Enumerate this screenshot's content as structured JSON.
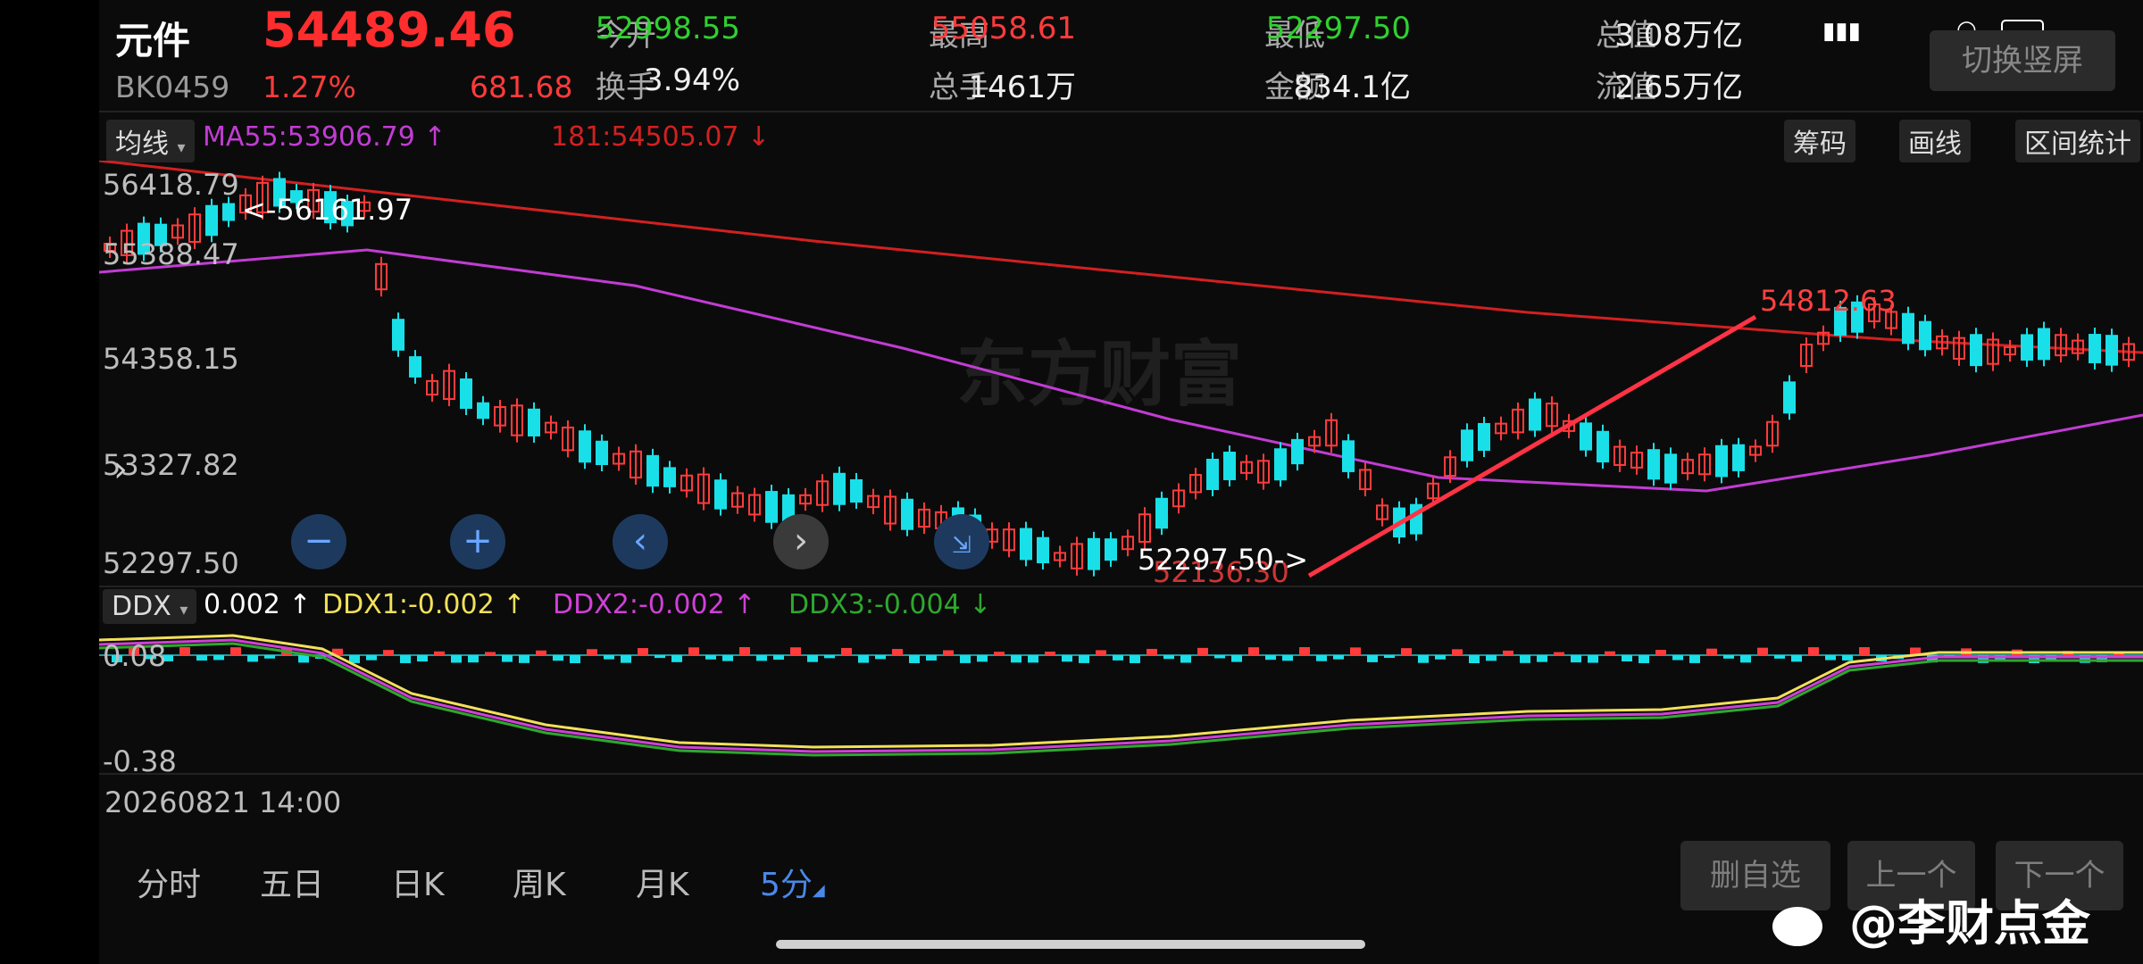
{
  "header": {
    "name": "元件",
    "price": "54489.46",
    "code": "BK0459",
    "change_pct": "1.27%",
    "change_abs": "681.68",
    "quotes": [
      {
        "label": "今开",
        "value": "52998.55",
        "color": "#2fd12f"
      },
      {
        "label": "最高",
        "value": "55058.61",
        "color": "#ff3b3b"
      },
      {
        "label": "最低",
        "value": "52297.50",
        "color": "#2fd12f"
      },
      {
        "label": "总值",
        "value": "3.08万亿",
        "color": "#eeeeee"
      },
      {
        "label": "换手",
        "value": "3.94%",
        "color": "#eeeeee"
      },
      {
        "label": "总手",
        "value": "1461万",
        "color": "#eeeeee"
      },
      {
        "label": "金额",
        "value": "834.1亿",
        "color": "#eeeeee"
      },
      {
        "label": "流值",
        "value": "2.65万亿",
        "color": "#eeeeee"
      }
    ],
    "switch_label": "切换竖屏",
    "status_icons": [
      "wifi-icon",
      "signal-icon",
      "battery-icon"
    ]
  },
  "toolbar": {
    "ma_button": "均线",
    "ma55": "MA55:53906.79 ↑",
    "ma181": "181:54505.07 ↓",
    "chip_button": "筹码",
    "draw_button": "画线",
    "range_button": "区间统计"
  },
  "kline": {
    "y_labels": [
      "56418.79",
      "55388.47",
      "54358.15",
      "53327.82",
      "52297.50"
    ],
    "high_marker": "<-56161.97",
    "right_high_marker": "54812.63",
    "low_marker": "52297.50->",
    "low_marker_shadow": "52136.30",
    "watermark": "东方财富",
    "colors": {
      "up": "#ff3b3b",
      "down": "#19e0e8",
      "ma55": "#c23cd4",
      "ma181": "#d32020",
      "trend": "#ff3344"
    }
  },
  "ddx": {
    "button": "DDX",
    "ddx": "0.002 ↑",
    "ddx1": "DDX1:-0.002 ↑",
    "ddx2": "DDX2:-0.002 ↑",
    "ddx3": "DDX3:-0.004 ↓",
    "y_labels": [
      "0.08",
      "-0.38"
    ],
    "colors": {
      "ddx1": "#f2e15a",
      "ddx2": "#d040d8",
      "ddx3": "#2ea82e"
    }
  },
  "footer": {
    "datetime": "20260821 14:00",
    "periods": [
      "分时",
      "五日",
      "日K",
      "周K",
      "月K",
      "5分"
    ],
    "active_period": "5分",
    "delete_label": "删自选",
    "prev_label": "上一个",
    "next_label": "下一个",
    "weibo": "@李财点金"
  }
}
